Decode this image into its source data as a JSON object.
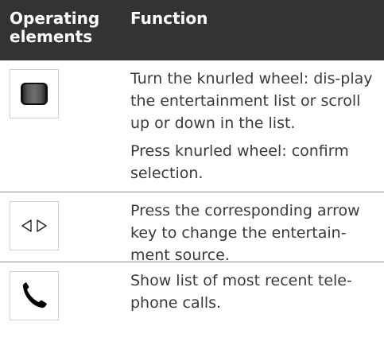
{
  "header": {
    "col_ops": "Operating elements",
    "col_func": "Function"
  },
  "rows": [
    {
      "icon": "knurled-wheel-icon",
      "paragraphs": [
        "Turn the knurled wheel: dis-play the entertainment list or scroll up or down in the list.",
        "Press knurled wheel: confirm selection."
      ]
    },
    {
      "icon": "arrow-keys-icon",
      "paragraphs": [
        "Press the corresponding arrow key to change the entertain-ment source."
      ]
    },
    {
      "icon": "phone-handset-icon",
      "paragraphs": [
        "Show list of most recent tele-phone calls."
      ]
    }
  ],
  "colors": {
    "header_bg": "#333333",
    "header_text": "#ffffff",
    "body_text": "#3a3a3a",
    "divider": "#8a8a8a"
  }
}
